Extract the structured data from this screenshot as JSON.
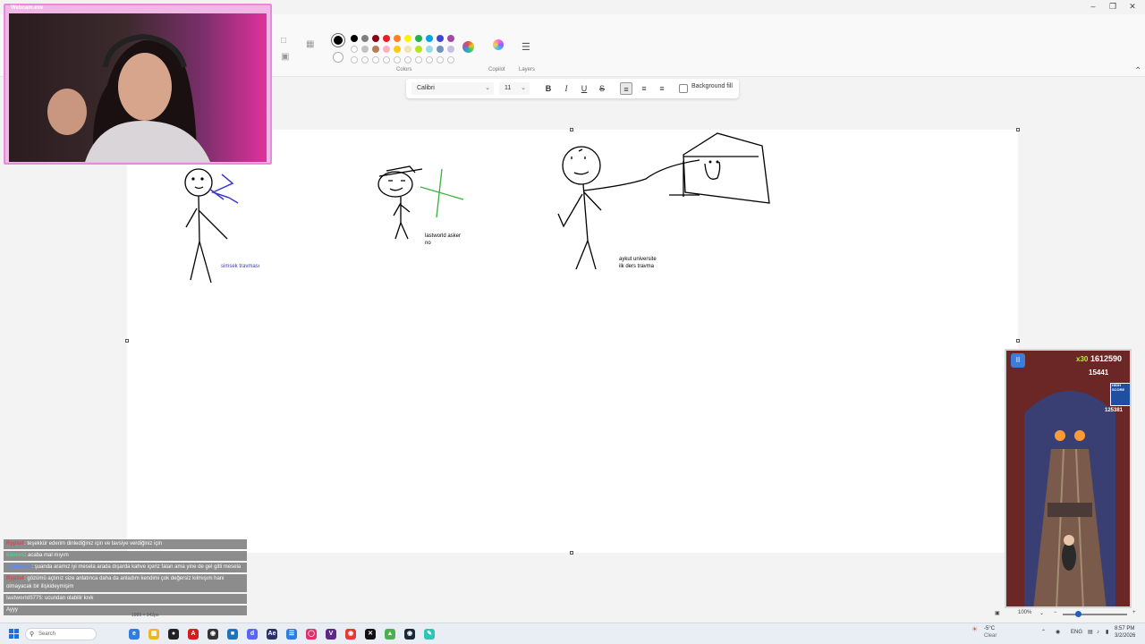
{
  "webcam": {
    "title": "Webcam.exe"
  },
  "ribbon": {
    "colors_label": "Colors",
    "copilot_label": "Copilot",
    "layers_label": "Layers",
    "swatches_row1": [
      "#000000",
      "#7f7f7f",
      "#880015",
      "#ed1c24",
      "#ff7f27",
      "#fff200",
      "#22b14c",
      "#00a2e8",
      "#3f48cc",
      "#a349a4"
    ],
    "swatches_row2": [
      "#ffffff",
      "#c3c3c3",
      "#b97a57",
      "#ffaec9",
      "#ffc90e",
      "#efe4b0",
      "#b5e61d",
      "#99d9ea",
      "#7092be",
      "#c8bfe7"
    ]
  },
  "textbar": {
    "font": "Calibri",
    "size": "11",
    "background_fill": "Background fill"
  },
  "drawing": {
    "caption1": "simsek travması",
    "caption2": "lastworld asker\nno",
    "caption3": "aykut universite\nilk ders travma"
  },
  "game": {
    "multiplier": "x30",
    "score": "1612590",
    "coins": "15441",
    "high_score_label": "HIGH SCORE",
    "high_score": "125381"
  },
  "chat": [
    {
      "user": "Ryplo4",
      "user_color": "#e0454b",
      "text": "teşekkür ederim dinlediğiniz için ve tavsiye verdiğiniz için"
    },
    {
      "user": "kilimini",
      "user_color": "#4fd08b",
      "text": "acaba mal mıyım"
    },
    {
      "user": "agitodove",
      "user_color": "#5a8ee8",
      "text": "şuanda aramız iyi mesela arada dışarda kahve içeriz falan ama yine de gel gitli mesela"
    },
    {
      "user": "Ryplo4",
      "user_color": "#e0454b",
      "text": "gözümü açtınız size anlatınca daha da anladım kendimi çok değersiz kılmışım hani olmayacak bir ilişkideymişim"
    },
    {
      "user": "lastworld5775",
      "user_color": "#dddddd",
      "text": "ucundan olabilir kıvk"
    },
    {
      "user": "",
      "user_color": "#dddddd",
      "text": "Ayyy"
    }
  ],
  "statusbar": {
    "dimensions": "1989 × 942px",
    "zoom": "100%"
  },
  "taskbar": {
    "search": "Search",
    "weather_temp": "-5°C",
    "weather_desc": "Clear",
    "lang": "ENG",
    "time": "8:57 PM",
    "date": "3/2/2026"
  }
}
